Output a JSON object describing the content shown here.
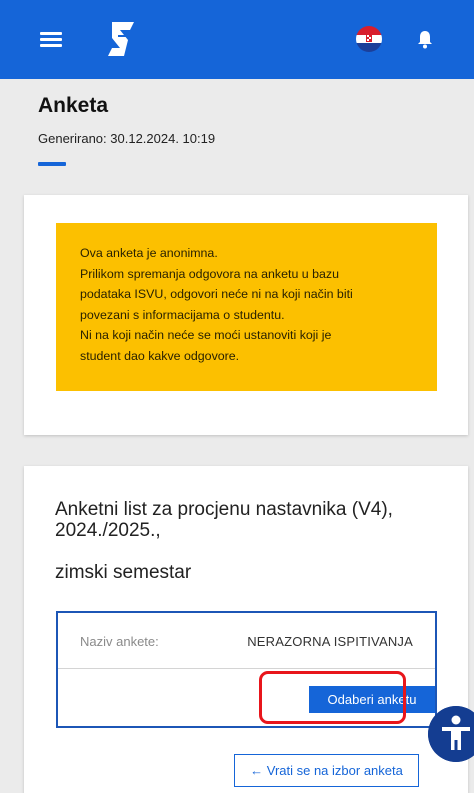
{
  "header": {
    "menu_icon": "hamburger-menu-icon",
    "logo": "isvu-logo",
    "language_icon": "croatian-flag-icon",
    "notification_icon": "bell-icon",
    "bar_color": "#1565d8"
  },
  "page": {
    "title": "Anketa",
    "generated": "Generirano: 30.12.2024. 10:19"
  },
  "notice": {
    "lines": [
      "Ova anketa je anonimna.",
      "Prilikom spremanja odgovora na anketu u bazu",
      "podataka ISVU, odgovori neće ni na koji način biti",
      "povezani s informacijama o studentu.",
      "Ni na koji način neće se moći ustanoviti koji je",
      "student dao kakve odgovore."
    ],
    "background_color": "#fcc000"
  },
  "survey": {
    "title": "Anketni list za procjenu nastavnika (V4), 2024./2025.,",
    "semester": "zimski semestar",
    "name_label": "Naziv ankete:",
    "name_value": "NERAZORNA ISPITIVANJA",
    "choose_button": "Odaberi anketu",
    "highlight_color": "#e8151b"
  },
  "back_button": "← Vrati se na izbor anketa",
  "accessibility_icon": "accessibility-icon"
}
